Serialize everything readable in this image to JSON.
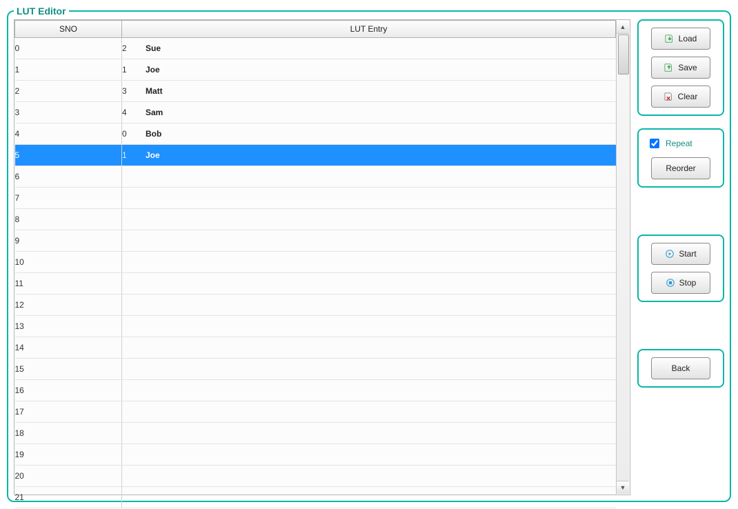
{
  "title": "LUT Editor",
  "columns": {
    "sno": "SNO",
    "entry": "LUT Entry"
  },
  "rows": [
    {
      "sno": "0",
      "idx": "2",
      "name": "Sue",
      "selected": false
    },
    {
      "sno": "1",
      "idx": "1",
      "name": "Joe",
      "selected": false
    },
    {
      "sno": "2",
      "idx": "3",
      "name": "Matt",
      "selected": false
    },
    {
      "sno": "3",
      "idx": "4",
      "name": "Sam",
      "selected": false
    },
    {
      "sno": "4",
      "idx": "0",
      "name": "Bob",
      "selected": false
    },
    {
      "sno": "5",
      "idx": "1",
      "name": "Joe",
      "selected": true
    },
    {
      "sno": "6",
      "idx": "",
      "name": "",
      "selected": false
    },
    {
      "sno": "7",
      "idx": "",
      "name": "",
      "selected": false
    },
    {
      "sno": "8",
      "idx": "",
      "name": "",
      "selected": false
    },
    {
      "sno": "9",
      "idx": "",
      "name": "",
      "selected": false
    },
    {
      "sno": "10",
      "idx": "",
      "name": "",
      "selected": false
    },
    {
      "sno": "11",
      "idx": "",
      "name": "",
      "selected": false
    },
    {
      "sno": "12",
      "idx": "",
      "name": "",
      "selected": false
    },
    {
      "sno": "13",
      "idx": "",
      "name": "",
      "selected": false
    },
    {
      "sno": "14",
      "idx": "",
      "name": "",
      "selected": false
    },
    {
      "sno": "15",
      "idx": "",
      "name": "",
      "selected": false
    },
    {
      "sno": "16",
      "idx": "",
      "name": "",
      "selected": false
    },
    {
      "sno": "17",
      "idx": "",
      "name": "",
      "selected": false
    },
    {
      "sno": "18",
      "idx": "",
      "name": "",
      "selected": false
    },
    {
      "sno": "19",
      "idx": "",
      "name": "",
      "selected": false
    },
    {
      "sno": "20",
      "idx": "",
      "name": "",
      "selected": false
    },
    {
      "sno": "21",
      "idx": "",
      "name": "",
      "selected": false
    }
  ],
  "buttons": {
    "load": "Load",
    "save": "Save",
    "clear": "Clear",
    "repeat": "Repeat",
    "reorder": "Reorder",
    "start": "Start",
    "stop": "Stop",
    "back": "Back"
  },
  "repeat_checked": true,
  "colors": {
    "accent": "#09b6a7",
    "selection": "#1e90ff"
  }
}
